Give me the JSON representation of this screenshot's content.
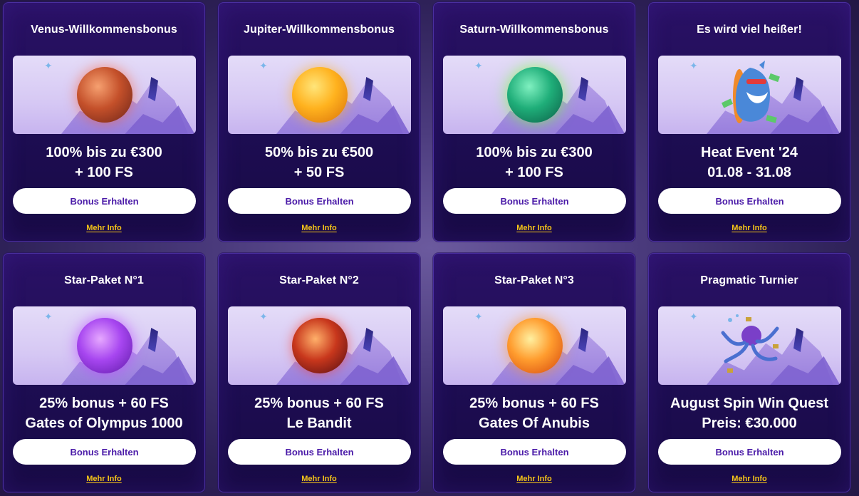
{
  "cards": [
    {
      "title": "Venus-Willkommensbonus",
      "offer_line1": "100% bis zu €300",
      "offer_line2": "+ 100 FS",
      "button": "Bonus Erhalten",
      "info": "Mehr Info",
      "image": "venus-planet"
    },
    {
      "title": "Jupiter-Willkommensbonus",
      "offer_line1": "50% bis zu €500",
      "offer_line2": "+ 50 FS",
      "button": "Bonus Erhalten",
      "info": "Mehr Info",
      "image": "jupiter-planet"
    },
    {
      "title": "Saturn-Willkommensbonus",
      "offer_line1": "100% bis zu €300",
      "offer_line2": "+ 100 FS",
      "button": "Bonus Erhalten",
      "info": "Mehr Info",
      "image": "saturn-planet"
    },
    {
      "title": "Es wird viel heißer!",
      "offer_line1": "Heat Event '24",
      "offer_line2": "01.08 - 31.08",
      "button": "Bonus Erhalten",
      "info": "Mehr Info",
      "image": "shark-surfer"
    },
    {
      "title": "Star-Paket N°1",
      "offer_line1": "25% bonus + 60 FS",
      "offer_line2": "Gates of Olympus 1000",
      "button": "Bonus Erhalten",
      "info": "Mehr Info",
      "image": "purple-planet"
    },
    {
      "title": "Star-Paket N°2",
      "offer_line1": "25% bonus + 60 FS",
      "offer_line2": "Le Bandit",
      "button": "Bonus Erhalten",
      "info": "Mehr Info",
      "image": "lava-planet"
    },
    {
      "title": "Star-Paket N°3",
      "offer_line1": "25% bonus + 60 FS",
      "offer_line2": "Gates Of Anubis",
      "button": "Bonus Erhalten",
      "info": "Mehr Info",
      "image": "orange-planet"
    },
    {
      "title": "Pragmatic Turnier",
      "offer_line1": "August Spin Win Quest",
      "offer_line2": "Preis: €30.000",
      "button": "Bonus Erhalten",
      "info": "Mehr Info",
      "image": "octopus"
    }
  ],
  "colors": {
    "button_text": "#4a1aa8",
    "info_link": "#f5c518",
    "card_bg": "#1d0d52"
  }
}
